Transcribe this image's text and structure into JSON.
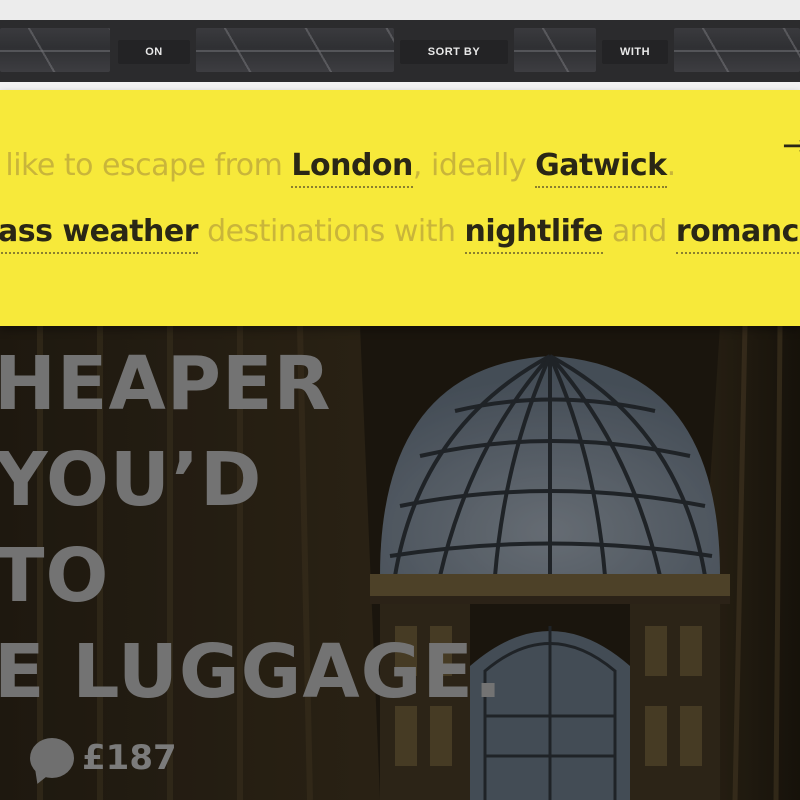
{
  "nav": {
    "on_label": "ON",
    "sort_label": "SORT BY",
    "with_label": "WITH"
  },
  "search": {
    "line1": {
      "text1": "I like to escape from",
      "origin": "London",
      "text2": ", ideally",
      "airport": "Gatwick",
      "text3": "."
    },
    "line2": {
      "weather": "ass weather",
      "text1": "destinations with",
      "interest1": "nightlife",
      "text2": "and",
      "interest2": "romance"
    },
    "go_icon": "arrow-right-icon"
  },
  "hero": {
    "headline_lines": [
      "HEAPER",
      "YOU’D",
      "TO",
      "E LUGGAGE."
    ],
    "price": "£187",
    "price_icon": "speech-bubble-icon"
  },
  "colors": {
    "banner": "#f7e93a",
    "navbar": "#2b2b2d",
    "muted_text": "#c9b53a",
    "selected_text": "#2a2716",
    "headline": "#737373"
  }
}
